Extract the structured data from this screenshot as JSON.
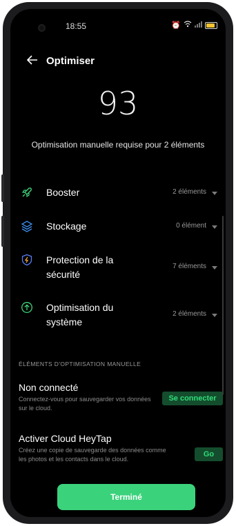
{
  "status_bar": {
    "time": "18:55"
  },
  "header": {
    "back_icon": "arrow-left-icon",
    "title": "Optimiser"
  },
  "score": "93",
  "subtitle": "Optimisation manuelle requise pour 2 éléments",
  "categories": [
    {
      "label": "Booster",
      "count": "2 éléments",
      "icon": "rocket-icon",
      "color": "#3fd47a"
    },
    {
      "label": "Stockage",
      "count": "0 élément",
      "icon": "layers-icon",
      "color": "#3d8ef0"
    },
    {
      "label": "Protection de la sécurité",
      "count": "7 éléments",
      "icon": "shield-icon",
      "color": "#5b7cf5"
    },
    {
      "label": "Optimisation du système",
      "count": "2 éléments",
      "icon": "upgrade-icon",
      "color": "#3fd47a"
    }
  ],
  "manual_section": {
    "title": "ÉLÉMENTS D'OPTIMISATION MANUELLE",
    "items": [
      {
        "title": "Non connecté",
        "description": "Connectez-vous pour sauvegarder vos données sur le cloud.",
        "action": "Se connecter"
      },
      {
        "title": "Activer Cloud HeyTap",
        "description": "Créez une copie de sauvegarde des données comme les photos et les contacts dans le cloud.",
        "action": "Go"
      }
    ]
  },
  "done_button": "Terminé"
}
